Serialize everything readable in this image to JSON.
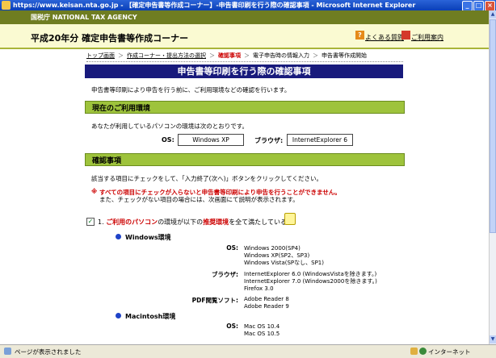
{
  "window": {
    "title": "https://www.keisan.nta.go.jp - 【確定申告書等作成コーナー】-申告書印刷を行う際の確認事項 - Microsoft Internet Explorer"
  },
  "agency": {
    "name": "国税庁 NATIONAL TAX AGENCY"
  },
  "header": {
    "title": "平成20年分 確定申告書等作成コーナー",
    "faq_link": "よくある質問",
    "guide_link": "ご利用案内"
  },
  "breadcrumb": [
    "トップ画面",
    "作成コーナー・提出方法の選択",
    "確認事項",
    "電子申告時の情報入力",
    "申告書等作成開始"
  ],
  "page": {
    "title": "申告書等印刷を行う際の確認事項",
    "intro": "申告書等印刷により申告を行う前に、ご利用環境などの確認を行います。"
  },
  "env": {
    "heading": "現在のご利用環境",
    "desc": "あなたが利用しているパソコンの環境は次のとおりです。",
    "os_label": "OS:",
    "os_value": "Windows XP",
    "browser_label": "ブラウザ:",
    "browser_value": "InternetExplorer 6"
  },
  "confirm": {
    "heading": "確認事項",
    "instruction": "該当する項目にチェックをして、「入力終了(次へ)」ボタンをクリックしてください。",
    "warning_mark": "※",
    "warning": "すべての項目にチェックが入らないと申告書等印刷により申告を行うことができません。",
    "note": "また、チェックがない項目の場合には、次画面にて説明が表示されます。",
    "item1_number": "1.",
    "item1_red": "ご利用のパソコン",
    "item1_mid": "の環境が以下の",
    "item1_red2": "推奨環境",
    "item1_tail": "を全て満たしている。",
    "item1_checked": true,
    "windows": {
      "heading": "Windows環境",
      "os_label": "OS:",
      "os_values": [
        "Windows 2000(SP4)",
        "Windows XP(SP2、SP3)",
        "Windows Vista(SPなし、SP1)"
      ],
      "browser_label": "ブラウザ:",
      "browser_values": [
        "InternetExplorer 6.0 (WindowsVistaを除きます。)",
        "InternetExplorer 7.0 (Windows2000を除きます。)",
        "Firefox 3.0"
      ],
      "pdf_label": "PDF閲覧ソフト:",
      "pdf_values": [
        "Adobe Reader 8",
        "Adobe Reader 9"
      ]
    },
    "mac": {
      "heading": "Macintosh環境",
      "os_label": "OS:",
      "os_values": [
        "Mac OS 10.4",
        "Mac OS 10.5"
      ]
    }
  },
  "status": {
    "left": "ページが表示されました",
    "right": "インターネット"
  },
  "colors": {
    "titlebar": "#0a3fb7",
    "agency": "#6f7d21",
    "header_bg": "#fafad2",
    "page_title": "#181a7c",
    "section": "#9ec33c",
    "warning": "#cc0000"
  }
}
